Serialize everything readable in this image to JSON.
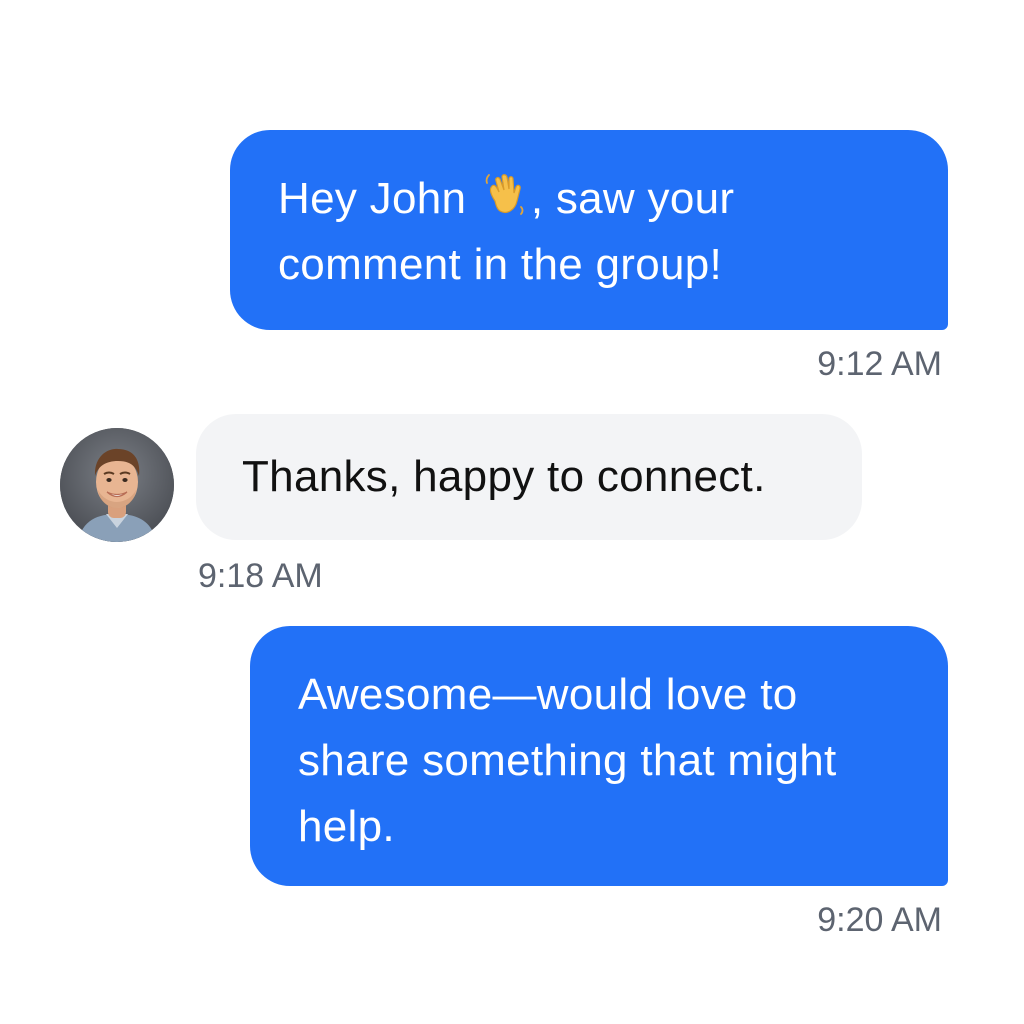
{
  "conversation": {
    "messages": [
      {
        "direction": "outgoing",
        "text_before_emoji": "Hey John ",
        "emoji": "waving-hand",
        "text_after_emoji": ", saw your comment in the group!",
        "time": "9:12 AM"
      },
      {
        "direction": "incoming",
        "sender_avatar": "avatar-photo",
        "text": "Thanks, happy to connect.",
        "time": "9:18 AM"
      },
      {
        "direction": "outgoing",
        "text": "Awesome—would love to share something that might help.",
        "time": "9:20 AM"
      }
    ]
  },
  "colors": {
    "outgoing_bubble": "#2271f7",
    "incoming_bubble": "#f3f4f6",
    "timestamp": "#5d6470"
  }
}
